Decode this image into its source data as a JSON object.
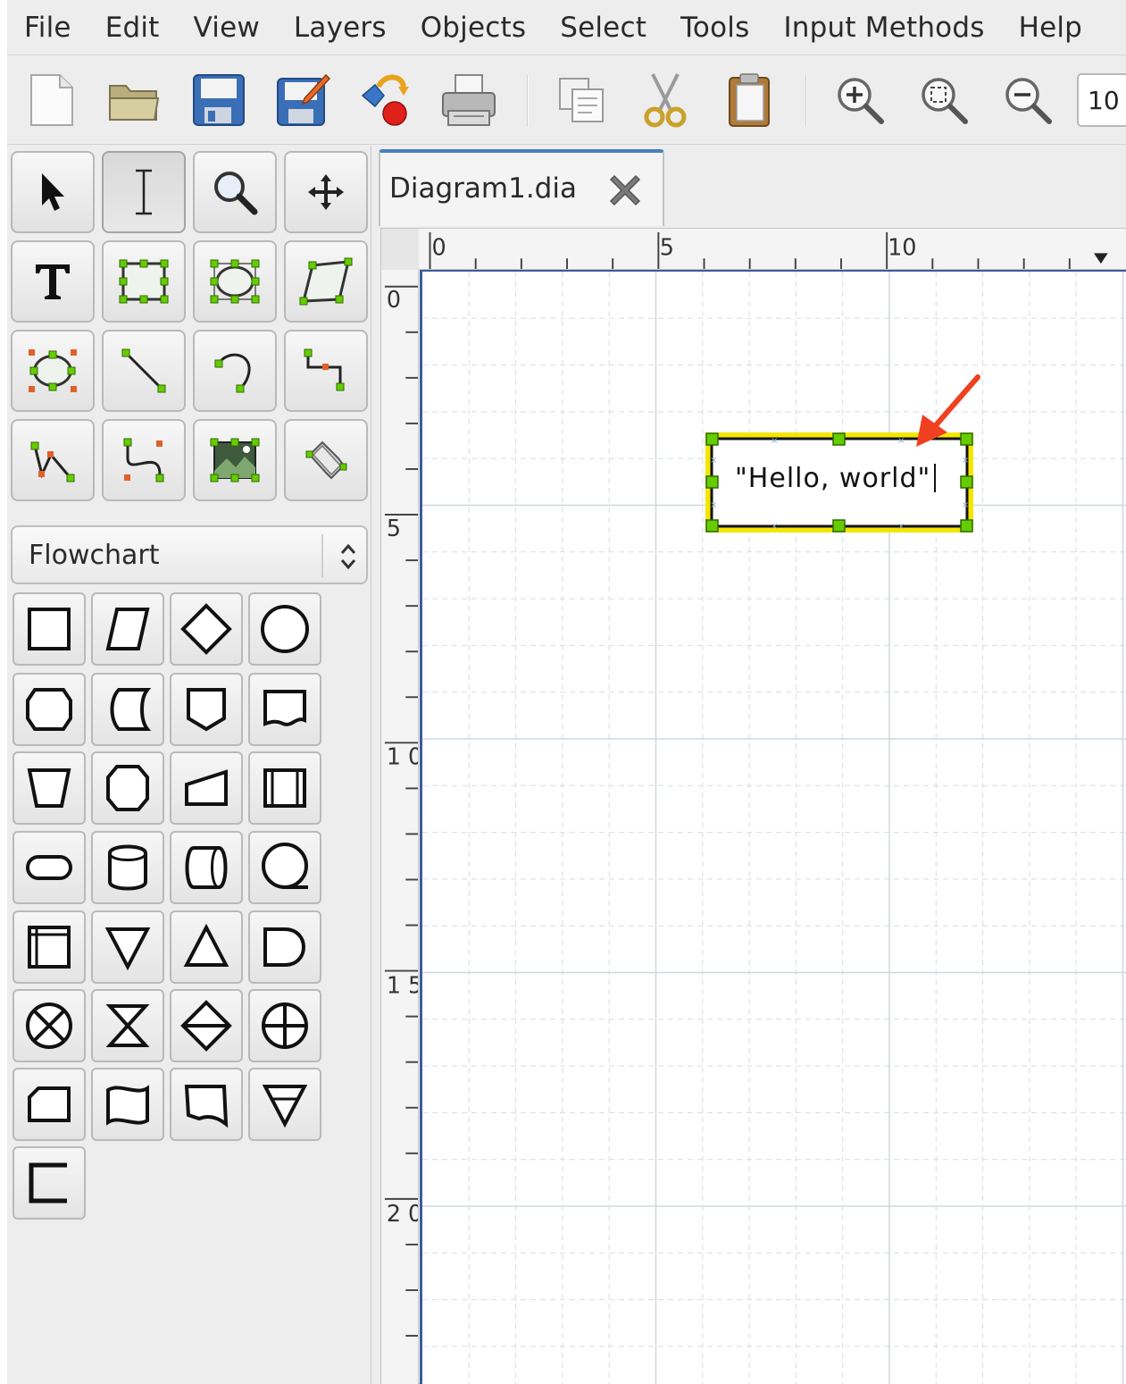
{
  "menu": {
    "items": [
      "File",
      "Edit",
      "View",
      "Layers",
      "Objects",
      "Select",
      "Tools",
      "Input Methods",
      "Help"
    ]
  },
  "toolbar": {
    "buttons": [
      "new-document-icon",
      "open-folder-icon",
      "save-icon",
      "save-as-icon",
      "export-icon",
      "print-icon",
      "copy-icon",
      "cut-icon",
      "paste-icon",
      "zoom-in-icon",
      "zoom-fit-icon",
      "zoom-out-icon"
    ],
    "zoom_value": "10"
  },
  "toolbox": {
    "tools": [
      "modify-tool",
      "text-edit-tool",
      "magnify-tool",
      "scroll-tool",
      "text-tool",
      "box-tool",
      "ellipse-tool",
      "polygon-tool",
      "beziergon-tool",
      "line-tool",
      "arc-tool",
      "zigzag-line-tool",
      "polyline-tool",
      "bezier-line-tool",
      "image-tool",
      "outline-tool"
    ],
    "active_tool": "text-edit-tool",
    "sheet": "Flowchart"
  },
  "document": {
    "tab_title": "Diagram1.dia",
    "text_object": "\"Hello, world\"",
    "selection_color": "#f5e600",
    "handle_color": "#66cc00",
    "pointer_arrow_color": "#f04020"
  },
  "rulers": {
    "horizontal_labels": [
      "0",
      "5",
      "10"
    ],
    "vertical_labels": [
      "0",
      "5",
      "1 0",
      "1 5",
      "2 0"
    ]
  }
}
